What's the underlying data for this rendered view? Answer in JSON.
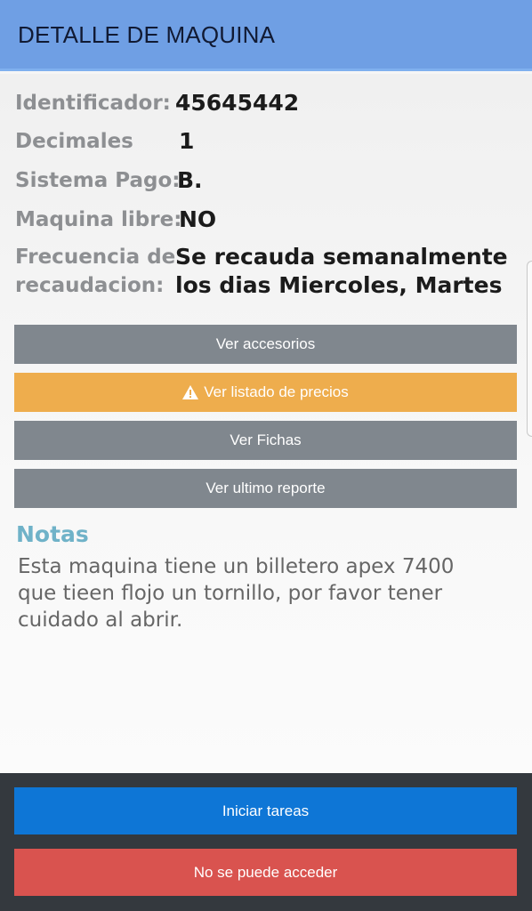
{
  "header": {
    "title": "DETALLE DE MAQUINA"
  },
  "details": {
    "identificador_label": "Identificador:",
    "identificador_value": "45645442",
    "decimales_label": "Decimales",
    "decimales_value": "1",
    "sistema_pago_label": "Sistema Pago:",
    "sistema_pago_value": "B.",
    "maquina_libre_label": "Maquina libre:",
    "maquina_libre_value": "NO",
    "frecuencia_label_line1": "Frecuencia de",
    "frecuencia_label_line2": "recaudacion:",
    "frecuencia_value_line1": "Se recauda semanalmente",
    "frecuencia_value_line2": "los dias Miercoles, Martes"
  },
  "buttons": {
    "accesorios": "Ver accesorios",
    "precios": "Ver listado de precios",
    "fichas": "Ver Fichas",
    "ultimo_reporte": "Ver ultimo reporte"
  },
  "notes": {
    "title": "Notas",
    "line1": "Esta maquina tiene un billetero apex 7400",
    "line2": "que tieen flojo un tornillo, por favor tener",
    "line3": "cuidado al abrir."
  },
  "footer": {
    "iniciar": "Iniciar tareas",
    "no_acceder": "No se puede acceder"
  },
  "icons": {
    "precios_icon": "warning-icon"
  },
  "colors": {
    "header": "#6f9fe4",
    "gray_button": "#80878e",
    "orange_button": "#eead4d",
    "blue_button": "#0e76d6",
    "red_button": "#d9534f",
    "notes_title": "#6fb2c8"
  }
}
